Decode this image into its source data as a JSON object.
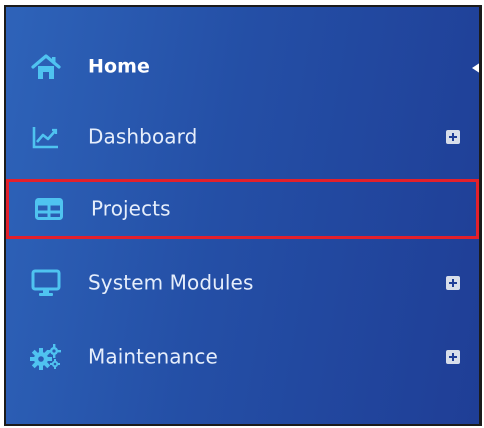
{
  "menu": {
    "items": [
      {
        "label": "Home",
        "icon": "home-icon",
        "selected": false,
        "expandable": false
      },
      {
        "label": "Dashboard",
        "icon": "line-chart-icon",
        "selected": false,
        "expandable": true
      },
      {
        "label": "Projects",
        "icon": "table-grid-icon",
        "selected": true,
        "expandable": false
      },
      {
        "label": "System Modules",
        "icon": "monitor-icon",
        "selected": false,
        "expandable": true
      },
      {
        "label": "Maintenance",
        "icon": "gears-icon",
        "selected": false,
        "expandable": true
      }
    ]
  },
  "colors": {
    "sidebar_gradient_start": "#2e63b9",
    "sidebar_gradient_end": "#1f3e96",
    "icon_color": "#4fc3f0",
    "selected_outline": "#e3202b",
    "text": "#e6eefb"
  }
}
